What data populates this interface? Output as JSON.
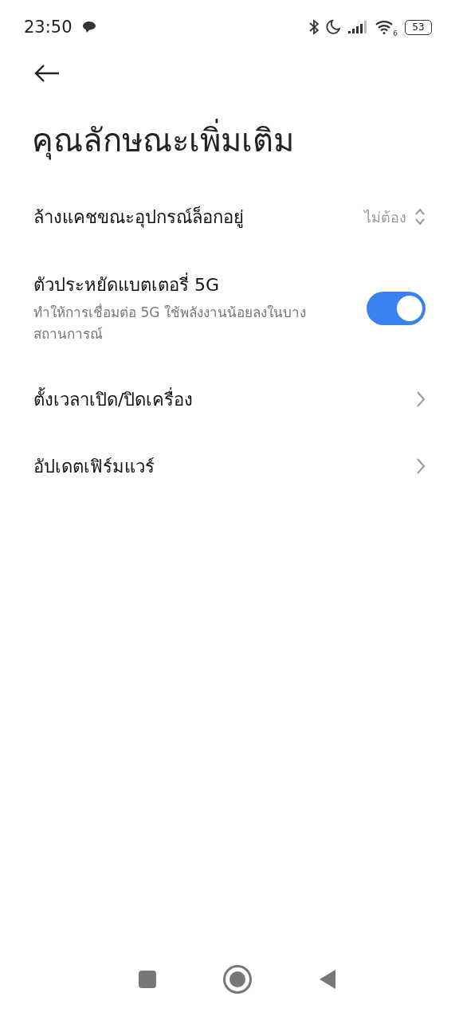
{
  "status_bar": {
    "time": "23:50",
    "wifi_badge": "6",
    "battery": "53"
  },
  "page": {
    "title": "คุณลักษณะเพิ่มเติม"
  },
  "settings": [
    {
      "kind": "select",
      "label": "ล้างแคชขณะอุปกรณ์ล็อกอยู่",
      "value": "ไม่ต้อง"
    },
    {
      "kind": "toggle",
      "label": "ตัวประหยัดแบตเตอรี่ 5G",
      "description": "ทำให้การเชื่อมต่อ 5G ใช้พลังงานน้อยลงในบางสถานการณ์",
      "on": true
    },
    {
      "kind": "link",
      "label": "ตั้งเวลาเปิด/ปิดเครื่อง"
    },
    {
      "kind": "link",
      "label": "อัปเดตเฟิร์มแวร์"
    }
  ]
}
